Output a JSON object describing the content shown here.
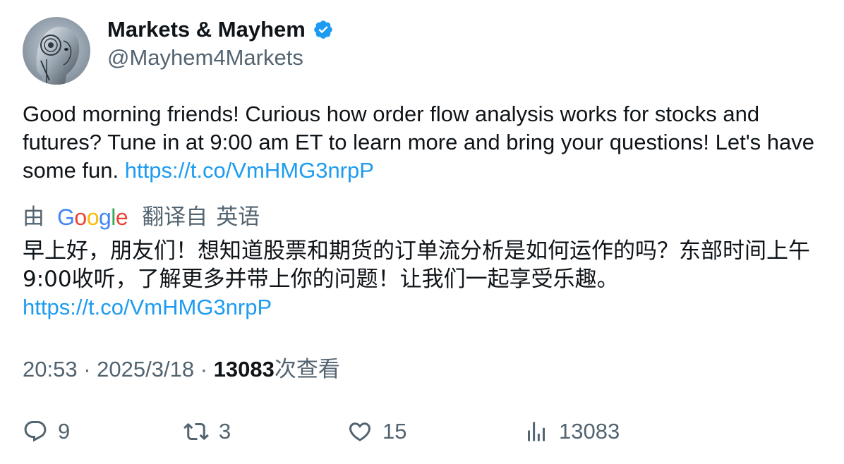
{
  "author": {
    "display_name": "Markets & Mayhem",
    "handle": "@Mayhem4Markets",
    "verified": true,
    "avatar_icon": "robot-avatar-icon"
  },
  "tweet": {
    "text": "Good morning friends! Curious how order flow analysis works for stocks and futures? Tune in at 9:00 am ET to learn more and bring your questions! Let's have some fun.",
    "link": "https://t.co/VmHMG3nrpP"
  },
  "translation": {
    "by_label": "由",
    "provider": "Google",
    "from_label": "翻译自",
    "language": "英语",
    "text": "早上好，朋友们！想知道股票和期货的订单流分析是如何运作的吗？东部时间上午9:00收听，了解更多并带上你的问题！让我们一起享受乐趣。",
    "link": "https://t.co/VmHMG3nrpP"
  },
  "meta": {
    "time": "20:53",
    "separator": "·",
    "date": "2025/3/18",
    "views_count": "13083",
    "views_label": "次查看"
  },
  "actions": {
    "replies": "9",
    "retweets": "3",
    "likes": "15",
    "views": "13083"
  },
  "colors": {
    "link": "#1d9bf0",
    "secondary_text": "#536471",
    "primary_text": "#0f1419",
    "verified_badge": "#1d9bf0"
  }
}
